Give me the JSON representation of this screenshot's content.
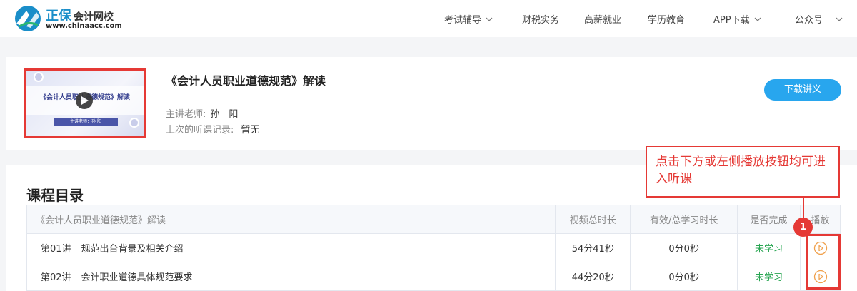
{
  "header": {
    "brand_name": "正保",
    "brand_sub": "会计网校",
    "brand_url": "www.chinaacc.com",
    "nav": [
      {
        "label": "考试辅导",
        "has_dropdown": true
      },
      {
        "label": "财税实务",
        "has_dropdown": false
      },
      {
        "label": "高薪就业",
        "has_dropdown": false
      },
      {
        "label": "学历教育",
        "has_dropdown": false
      },
      {
        "label": "APP下载",
        "has_dropdown": true
      },
      {
        "label": "公众号",
        "has_dropdown": true
      }
    ]
  },
  "course": {
    "title": "《会计人员职业道德规范》解读",
    "thumbnail_title": "《会计人员职业道德规范》解读",
    "thumbnail_teacher": "主讲老师：孙 阳",
    "teacher_label": "主讲老师:",
    "teacher_value": "孙　阳",
    "last_record_label": "上次的听课记录:",
    "last_record_value": "暂无",
    "download_label": "下载讲义"
  },
  "catalog": {
    "title": "课程目录",
    "columns": [
      "《会计人员职业道德规范》解读",
      "视频总时长",
      "有效/总学习时长",
      "是否完成",
      "播放"
    ],
    "rows": [
      {
        "no": "第01讲",
        "name": "规范出台背景及相关介绍",
        "duration": "54分41秒",
        "effective": "0分0秒",
        "status": "未学习"
      },
      {
        "no": "第02讲",
        "name": "会计职业道德具体规范要求",
        "duration": "44分20秒",
        "effective": "0分0秒",
        "status": "未学习"
      }
    ]
  },
  "annotation": {
    "tip": "点击下方或左侧播放按钮均可进入听课",
    "marker": "1"
  },
  "colors": {
    "accent": "#28a6ee",
    "annotation": "#e53935",
    "status": "#2aa653",
    "play_icon": "#f0a04b"
  }
}
